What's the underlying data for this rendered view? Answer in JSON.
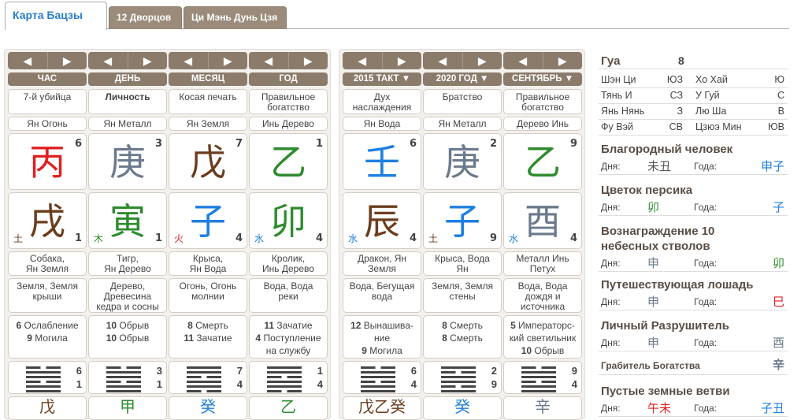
{
  "tabs": [
    "Карта Бацзы",
    "12 Дворцов",
    "Ци Мэнь Дунь Цзя"
  ],
  "nav_prev": "◀",
  "nav_next": "▶",
  "natal": [
    {
      "label": "ЧАС",
      "god": "7-й убийца",
      "god_bold": false,
      "stem_elem": "Ян Огонь",
      "stem": "丙",
      "stem_color": "#e02020",
      "stem_num": "6",
      "branch": "戌",
      "branch_color": "#6b3d1d",
      "branch_num": "1",
      "branch_elem": "土",
      "branch_elem_color": "#6b3d1d",
      "animal": "Собака,\nЯн Земля",
      "nayin": "Земля, Земля\nкрыши",
      "stages": "<b>6</b> Ослабление\n<b>9</b> Могила",
      "hex_top": "6",
      "hex_bot": "1",
      "next_chars": "戊",
      "next_color": "#6b3d1d"
    },
    {
      "label": "ДЕНЬ",
      "god": "Личность",
      "god_bold": true,
      "stem_elem": "Ян Металл",
      "stem": "庚",
      "stem_color": "#6b7a8c",
      "stem_num": "3",
      "branch": "寅",
      "branch_color": "#2e8b2e",
      "branch_num": "1",
      "branch_elem": "木",
      "branch_elem_color": "#2e8b2e",
      "animal": "Тигр,\nЯн Дерево",
      "nayin": "Дерево,\nДревесина\nкедра и сосны",
      "stages": "<b>10</b> Обрыв\n<b>10</b> Обрыв",
      "hex_top": "3",
      "hex_bot": "1",
      "next_chars": "甲",
      "next_color": "#2e8b2e"
    },
    {
      "label": "МЕСЯЦ",
      "god": "Косая печать",
      "god_bold": false,
      "stem_elem": "Ян Земля",
      "stem": "戊",
      "stem_color": "#6b3d1d",
      "stem_num": "7",
      "branch": "子",
      "branch_color": "#1e7fe0",
      "branch_num": "4",
      "branch_elem": "火",
      "branch_elem_color": "#e02020",
      "animal": "Крыса,\nЯн Вода",
      "nayin": "Огонь, Огонь\nмолнии",
      "stages": "<b>8</b> Смерть\n<b>11</b> Зачатие",
      "hex_top": "7",
      "hex_bot": "4",
      "next_chars": "癸",
      "next_color": "#1e7fe0"
    },
    {
      "label": "ГОД",
      "god": "Правильное\nбогатство",
      "god_bold": false,
      "stem_elem": "Инь Дерево",
      "stem": "乙",
      "stem_color": "#2e8b2e",
      "stem_num": "1",
      "branch": "卯",
      "branch_color": "#2e8b2e",
      "branch_num": "4",
      "branch_elem": "水",
      "branch_elem_color": "#1e7fe0",
      "animal": "Кролик,\nИнь Дерево",
      "nayin": "Вода, Вода\nреки",
      "stages": "<b>11</b> Зачатие\n<b>4</b> Поступление\nна службу",
      "hex_top": "1",
      "hex_bot": "4",
      "next_chars": "乙",
      "next_color": "#2e8b2e"
    }
  ],
  "luck": [
    {
      "label": "2015 ТАКТ ▼",
      "god": "Дух\nнаслаждения",
      "stem_elem": "Ян Вода",
      "stem": "壬",
      "stem_color": "#1e7fe0",
      "stem_num": "6",
      "branch": "辰",
      "branch_color": "#6b3d1d",
      "branch_num": "4",
      "branch_elem": "水",
      "branch_elem_color": "#1e7fe0",
      "animal": "Дракон, Ян\nЗемля",
      "nayin": "Вода, Бегущая\nвода",
      "stages": "<b>12</b> Вынашива-\nние\n<b>9</b> Могила",
      "hex_top": "6",
      "hex_bot": "4",
      "next_chars": "戊乙癸",
      "next_color": "#6b3d1d"
    },
    {
      "label": "2020 ГОД ▼",
      "god": "Братство",
      "stem_elem": "Ян Металл",
      "stem": "庚",
      "stem_color": "#6b7a8c",
      "stem_num": "2",
      "branch": "子",
      "branch_color": "#1e7fe0",
      "branch_num": "9",
      "branch_elem": "土",
      "branch_elem_color": "#6b3d1d",
      "animal": "Крыса, Вода\nЯн",
      "nayin": "Земля, Земля\nстены",
      "stages": "<b>8</b> Смерть\n<b>8</b> Смерть",
      "hex_top": "2",
      "hex_bot": "9",
      "next_chars": "癸",
      "next_color": "#1e7fe0"
    },
    {
      "label": "СЕНТЯБРЬ ▼",
      "god": "Правильное\nбогатство",
      "stem_elem": "Дерево Инь",
      "stem": "乙",
      "stem_color": "#2e8b2e",
      "stem_num": "9",
      "branch": "酉",
      "branch_color": "#6b7a8c",
      "branch_num": "4",
      "branch_elem": "水",
      "branch_elem_color": "#1e7fe0",
      "animal": "Металл Инь\nПетух",
      "nayin": "Вода, Вода\nдождя и\nисточника",
      "stages": "<b>5</b> Императорс-\nкий светильник\n<b>10</b> Обрыв",
      "hex_top": "9",
      "hex_bot": "4",
      "next_chars": "辛",
      "next_color": "#6b7a8c"
    }
  ],
  "side": {
    "gua_label": "Гуа",
    "gua_value": "8",
    "dirs": [
      [
        "Шэн Ци",
        "ЮЗ",
        "Хо Хай",
        "Ю"
      ],
      [
        "Тянь И",
        "СЗ",
        "У Гуй",
        "С"
      ],
      [
        "Янь Нянь",
        "З",
        "Лю Ша",
        "В"
      ],
      [
        "Фу Вэй",
        "СВ",
        "Цзюэ Мин",
        "ЮВ"
      ]
    ],
    "day_label": "Дня:",
    "year_label": "Года:",
    "stars": [
      {
        "title": "Благородный человек",
        "day": "未丑",
        "day_color": "#555",
        "year": "申子",
        "year_color": "#1e7fe0"
      },
      {
        "title": "Цветок персика",
        "day": "卯",
        "day_color": "#2e8b2e",
        "year": "子",
        "year_color": "#1e7fe0"
      },
      {
        "title": "Вознаграждение 10\nнебесных стволов",
        "day": "申",
        "day_color": "#6b7a8c",
        "year": "卯",
        "year_color": "#2e8b2e"
      },
      {
        "title": "Путешествующая лошадь",
        "day": "申",
        "day_color": "#6b7a8c",
        "year": "巳",
        "year_color": "#e02020"
      },
      {
        "title": "Личный Разрушитель",
        "day": "申",
        "day_color": "#6b7a8c",
        "year": "酉",
        "year_color": "#6b7a8c"
      }
    ],
    "robber_label": "Грабитель Богатства",
    "robber_value": "辛",
    "empty_title": "Пустые земные ветви",
    "empty_day": "午未",
    "empty_year": "子丑"
  }
}
